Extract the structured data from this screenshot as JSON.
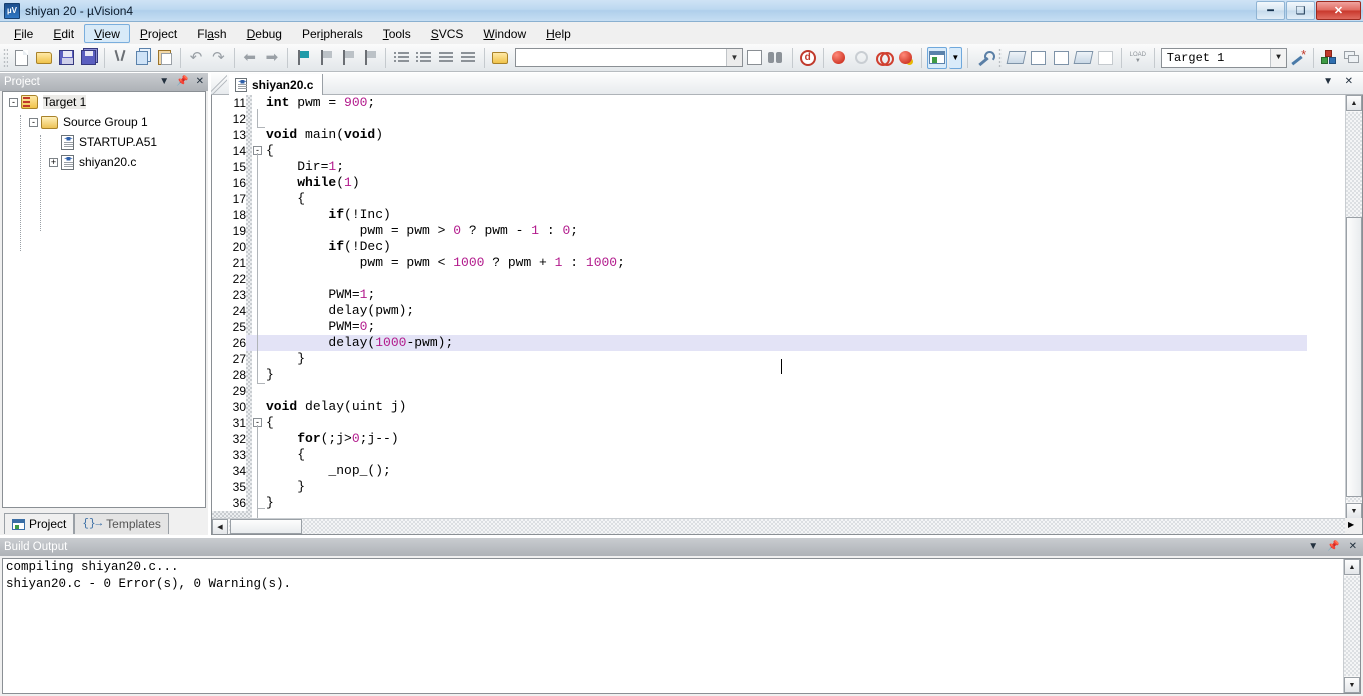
{
  "window": {
    "title": "shiyan 20  - µVision4",
    "app_icon": "uvision-icon",
    "controls": {
      "minimize": "–",
      "maximize": "❐",
      "close": "✕"
    }
  },
  "menubar": {
    "items": [
      {
        "label": "File",
        "accel": "F",
        "active": false
      },
      {
        "label": "Edit",
        "accel": "E",
        "active": false
      },
      {
        "label": "View",
        "accel": "V",
        "active": true
      },
      {
        "label": "Project",
        "accel": "P",
        "active": false
      },
      {
        "label": "Flash",
        "accel": "a",
        "active": false
      },
      {
        "label": "Debug",
        "accel": "D",
        "active": false
      },
      {
        "label": "Peripherals",
        "accel": "i",
        "active": false
      },
      {
        "label": "Tools",
        "accel": "T",
        "active": false
      },
      {
        "label": "SVCS",
        "accel": "S",
        "active": false
      },
      {
        "label": "Window",
        "accel": "W",
        "active": false
      },
      {
        "label": "Help",
        "accel": "H",
        "active": false
      }
    ]
  },
  "toolbar": {
    "buttons": [
      "new-file-icon",
      "open-file-icon",
      "save-icon",
      "save-all-icon",
      "cut-icon",
      "copy-icon",
      "paste-icon",
      "undo-icon",
      "redo-icon",
      "navigate-back-icon",
      "navigate-forward-icon",
      "bookmark-toggle-icon",
      "bookmark-prev-icon",
      "bookmark-next-icon",
      "bookmark-clear-icon",
      "indent-icon",
      "outdent-icon",
      "comment-icon",
      "uncomment-icon",
      "open-project-icon"
    ],
    "find_combo": {
      "value": "",
      "placeholder": ""
    },
    "buttons2": [
      "find-in-files-icon",
      "incremental-find-icon",
      "debug-query-icon",
      "insert-breakpoint-icon",
      "kill-breakpoint-icon",
      "disable-breakpoint-icon",
      "kill-all-breakpoints-icon",
      "project-window-icon",
      "project-window-dropdown-icon",
      "configuration-wizard-icon",
      "build-target-icon",
      "rebuild-all-icon",
      "batch-build-icon",
      "translate-file-icon",
      "stop-build-icon",
      "download-icon"
    ],
    "target_select": {
      "value": "Target 1",
      "label": "target-selector"
    },
    "buttons3": [
      "target-options-icon",
      "manage-components-icon",
      "multi-project-icon"
    ]
  },
  "project_panel": {
    "title": "Project",
    "header_buttons": [
      "panel-menu-icon",
      "auto-hide-pin-icon",
      "panel-close-icon"
    ],
    "tree": [
      {
        "label": "Target 1",
        "icon": "target-folder-icon",
        "depth": 0,
        "expander": "-",
        "selected": true
      },
      {
        "label": "Source Group 1",
        "icon": "source-group-folder-icon",
        "depth": 1,
        "expander": "-",
        "selected": false
      },
      {
        "label": "STARTUP.A51",
        "icon": "source-file-icon",
        "depth": 2,
        "expander": "",
        "selected": false
      },
      {
        "label": "shiyan20.c",
        "icon": "source-file-icon",
        "depth": 2,
        "expander": "+",
        "selected": false
      }
    ],
    "tabs": [
      {
        "label": "Project",
        "icon": "project-window-icon",
        "active": true
      },
      {
        "label": "Templates",
        "icon": "templates-icon",
        "active": false
      }
    ]
  },
  "editor": {
    "tab": {
      "label": "shiyan20.c",
      "icon": "c-source-file-icon"
    },
    "panel_buttons": [
      "editor-menu-icon",
      "editor-close-icon"
    ],
    "cursor_line": 26,
    "lines": [
      {
        "n": 11,
        "fold": "",
        "text": "int pwm = 900;",
        "spans": [
          {
            "t": "int",
            "c": "kw"
          },
          {
            "t": " pwm = ",
            "c": ""
          },
          {
            "t": "900",
            "c": "num"
          },
          {
            "t": ";",
            "c": ""
          }
        ]
      },
      {
        "n": 12,
        "fold": "",
        "text": "",
        "spans": []
      },
      {
        "n": 13,
        "fold": "",
        "text": "void main(void)",
        "spans": [
          {
            "t": "void",
            "c": "kw"
          },
          {
            "t": " main(",
            "c": ""
          },
          {
            "t": "void",
            "c": "kw"
          },
          {
            "t": ")",
            "c": ""
          }
        ]
      },
      {
        "n": 14,
        "fold": "-",
        "text": "{",
        "spans": [
          {
            "t": "{",
            "c": ""
          }
        ]
      },
      {
        "n": 15,
        "fold": "",
        "text": "    Dir=1;",
        "spans": [
          {
            "t": "    Dir=",
            "c": ""
          },
          {
            "t": "1",
            "c": "num"
          },
          {
            "t": ";",
            "c": ""
          }
        ]
      },
      {
        "n": 16,
        "fold": "",
        "text": "    while(1)",
        "spans": [
          {
            "t": "    ",
            "c": ""
          },
          {
            "t": "while",
            "c": "kw"
          },
          {
            "t": "(",
            "c": ""
          },
          {
            "t": "1",
            "c": "num"
          },
          {
            "t": ")",
            "c": ""
          }
        ]
      },
      {
        "n": 17,
        "fold": "",
        "text": "    {",
        "spans": [
          {
            "t": "    {",
            "c": ""
          }
        ]
      },
      {
        "n": 18,
        "fold": "",
        "text": "        if(!Inc)",
        "spans": [
          {
            "t": "        ",
            "c": ""
          },
          {
            "t": "if",
            "c": "kw"
          },
          {
            "t": "(!Inc)",
            "c": ""
          }
        ]
      },
      {
        "n": 19,
        "fold": "",
        "text": "            pwm = pwm > 0 ? pwm - 1 : 0;",
        "spans": [
          {
            "t": "            pwm = pwm > ",
            "c": ""
          },
          {
            "t": "0",
            "c": "num"
          },
          {
            "t": " ? pwm - ",
            "c": ""
          },
          {
            "t": "1",
            "c": "num"
          },
          {
            "t": " : ",
            "c": ""
          },
          {
            "t": "0",
            "c": "num"
          },
          {
            "t": ";",
            "c": ""
          }
        ]
      },
      {
        "n": 20,
        "fold": "",
        "text": "        if(!Dec)",
        "spans": [
          {
            "t": "        ",
            "c": ""
          },
          {
            "t": "if",
            "c": "kw"
          },
          {
            "t": "(!Dec)",
            "c": ""
          }
        ]
      },
      {
        "n": 21,
        "fold": "",
        "text": "            pwm = pwm < 1000 ? pwm + 1 : 1000;",
        "spans": [
          {
            "t": "            pwm = pwm < ",
            "c": ""
          },
          {
            "t": "1000",
            "c": "num"
          },
          {
            "t": " ? pwm + ",
            "c": ""
          },
          {
            "t": "1",
            "c": "num"
          },
          {
            "t": " : ",
            "c": ""
          },
          {
            "t": "1000",
            "c": "num"
          },
          {
            "t": ";",
            "c": ""
          }
        ]
      },
      {
        "n": 22,
        "fold": "",
        "text": "",
        "spans": []
      },
      {
        "n": 23,
        "fold": "",
        "text": "        PWM=1;",
        "spans": [
          {
            "t": "        PWM=",
            "c": ""
          },
          {
            "t": "1",
            "c": "num"
          },
          {
            "t": ";",
            "c": ""
          }
        ]
      },
      {
        "n": 24,
        "fold": "",
        "text": "        delay(pwm);",
        "spans": [
          {
            "t": "        delay(pwm);",
            "c": ""
          }
        ]
      },
      {
        "n": 25,
        "fold": "",
        "text": "        PWM=0;",
        "spans": [
          {
            "t": "        PWM=",
            "c": ""
          },
          {
            "t": "0",
            "c": "num"
          },
          {
            "t": ";",
            "c": ""
          }
        ]
      },
      {
        "n": 26,
        "fold": "",
        "text": "        delay(1000-pwm);",
        "spans": [
          {
            "t": "        delay(",
            "c": ""
          },
          {
            "t": "1000",
            "c": "num"
          },
          {
            "t": "-pwm);",
            "c": ""
          }
        ]
      },
      {
        "n": 27,
        "fold": "",
        "text": "    }",
        "spans": [
          {
            "t": "    }",
            "c": ""
          }
        ]
      },
      {
        "n": 28,
        "fold": "",
        "text": "}",
        "spans": [
          {
            "t": "}",
            "c": ""
          }
        ]
      },
      {
        "n": 29,
        "fold": "",
        "text": "",
        "spans": []
      },
      {
        "n": 30,
        "fold": "",
        "text": "void delay(uint j)",
        "spans": [
          {
            "t": "void",
            "c": "kw"
          },
          {
            "t": " delay(uint j)",
            "c": ""
          }
        ]
      },
      {
        "n": 31,
        "fold": "-",
        "text": "{",
        "spans": [
          {
            "t": "{",
            "c": ""
          }
        ]
      },
      {
        "n": 32,
        "fold": "",
        "text": "    for(;j>0;j--)",
        "spans": [
          {
            "t": "    ",
            "c": ""
          },
          {
            "t": "for",
            "c": "kw"
          },
          {
            "t": "(;j>",
            "c": ""
          },
          {
            "t": "0",
            "c": "num"
          },
          {
            "t": ";j--)",
            "c": ""
          }
        ]
      },
      {
        "n": 33,
        "fold": "",
        "text": "    {",
        "spans": [
          {
            "t": "    {",
            "c": ""
          }
        ]
      },
      {
        "n": 34,
        "fold": "",
        "text": "        _nop_();",
        "spans": [
          {
            "t": "        _nop_();",
            "c": ""
          }
        ]
      },
      {
        "n": 35,
        "fold": "",
        "text": "    }",
        "spans": [
          {
            "t": "    }",
            "c": ""
          }
        ]
      },
      {
        "n": 36,
        "fold": "",
        "text": "}",
        "spans": [
          {
            "t": "}",
            "c": ""
          }
        ]
      }
    ]
  },
  "build_output": {
    "title": "Build Output",
    "header_buttons": [
      "panel-menu-icon",
      "auto-hide-pin-icon",
      "panel-close-icon"
    ],
    "lines": [
      "compiling shiyan20.c...",
      "shiyan20.c - 0 Error(s), 0 Warning(s)."
    ]
  },
  "colors": {
    "title_bar": "#bcd8f0",
    "menu_highlight": "#d8eaf8",
    "panel_header": "#aeb2b7",
    "current_line": "#e3e3f6",
    "number_literal": "#b21a8c",
    "keyword": "#000000",
    "close_button": "#c8382c"
  }
}
